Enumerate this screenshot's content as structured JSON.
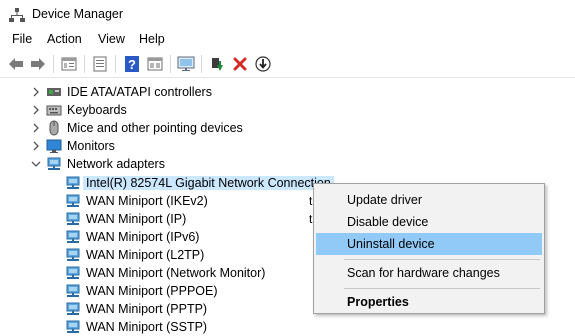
{
  "window": {
    "title": "Device Manager"
  },
  "menu": [
    "File",
    "Action",
    "View",
    "Help"
  ],
  "toolbar": {
    "icons": [
      "back-arrow-icon",
      "forward-arrow-icon",
      "properties-icon",
      "list-icon",
      "help-icon",
      "view-icon",
      "monitor-icon",
      "update-driver-icon",
      "uninstall-icon",
      "download-icon"
    ],
    "accent": {
      "help_blue": "#2b59c3",
      "uninstall_red": "#d42a2a",
      "update_green": "#1f8a3a"
    }
  },
  "tree": {
    "categories": [
      {
        "label": "IDE ATA/ATAPI controllers",
        "expanded": false
      },
      {
        "label": "Keyboards",
        "expanded": false
      },
      {
        "label": "Mice and other pointing devices",
        "expanded": false
      },
      {
        "label": "Monitors",
        "expanded": false
      },
      {
        "label": "Network adapters",
        "expanded": true
      }
    ],
    "devices": [
      {
        "label": "Intel(R) 82574L Gigabit Network Connection",
        "selected": true
      },
      {
        "label": "WAN Miniport (IKEv2)",
        "suffix": "t"
      },
      {
        "label": "WAN Miniport (IP)",
        "suffix": "t"
      },
      {
        "label": "WAN Miniport (IPv6)"
      },
      {
        "label": "WAN Miniport (L2TP)"
      },
      {
        "label": "WAN Miniport (Network Monitor)"
      },
      {
        "label": "WAN Miniport (PPPOE)"
      },
      {
        "label": "WAN Miniport (PPTP)"
      },
      {
        "label": "WAN Miniport (SSTP)"
      }
    ]
  },
  "context_menu": {
    "items": [
      "Update driver",
      "Disable device",
      "Uninstall device",
      "Scan for hardware changes",
      "Properties"
    ],
    "highlighted": "Uninstall device",
    "highlight_color": "#91c9f7"
  },
  "colors": {
    "selection": "#cce8ff",
    "menu_bg": "#f2f2f2"
  }
}
